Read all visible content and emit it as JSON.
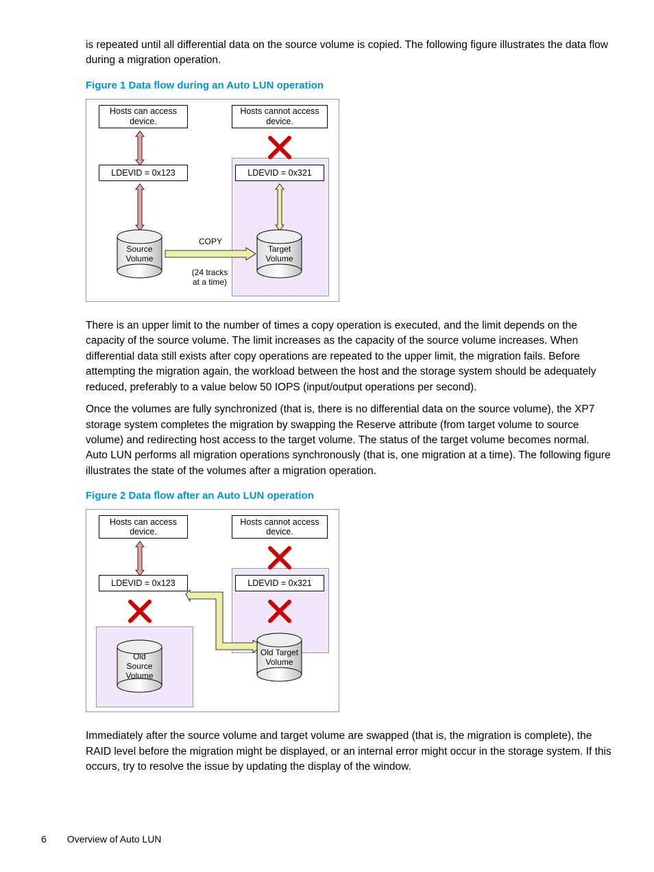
{
  "para_top": "is repeated until all differential data on the source volume is copied. The following figure illustrates the data flow during a migration operation.",
  "fig1": {
    "caption": "Figure 1 Data flow during an Auto LUN operation",
    "host_access": "Hosts can access device.",
    "host_noaccess": "Hosts cannot access device.",
    "ldev_left": "LDEVID = 0x123",
    "ldev_right": "LDEVID = 0x321",
    "src_vol": "Source Volume",
    "tgt_vol": "Target Volume",
    "copy": "COPY",
    "tracks": "(24 tracks at a time)"
  },
  "para_mid1": "There is an upper limit to the number of times a copy operation is executed, and the limit depends on the capacity of the source volume. The limit increases as the capacity of the source volume increases. When differential data still exists after copy operations are repeated to the upper limit, the migration fails. Before attempting the migration again, the workload between the host and the storage system should be adequately reduced, preferably to a value below 50 IOPS (input/output operations per second).",
  "para_mid2": "Once the volumes are fully synchronized (that is, there is no differential data on the source volume), the XP7 storage system completes the migration by swapping the Reserve attribute (from target volume to source volume) and redirecting host access to the target volume. The status of the target volume becomes normal. Auto LUN performs all migration operations synchronously (that is, one migration at a time). The following figure illustrates the state of the volumes after a migration operation.",
  "fig2": {
    "caption": "Figure 2 Data flow after an Auto LUN operation",
    "host_access": "Hosts can access device.",
    "host_noaccess": "Hosts cannot access device.",
    "ldev_left": "LDEVID = 0x123",
    "ldev_right": "LDEVID = 0x321",
    "old_src": "Old Source Volume",
    "old_tgt": "Old Target Volume"
  },
  "para_bottom": "Immediately after the source volume and target volume are swapped (that is, the migration is complete), the RAID level before the migration might be displayed, or an internal error might occur in the storage system. If this occurs, try to resolve the issue by updating the display of the window.",
  "footer": {
    "page": "6",
    "section": "Overview of Auto LUN"
  }
}
